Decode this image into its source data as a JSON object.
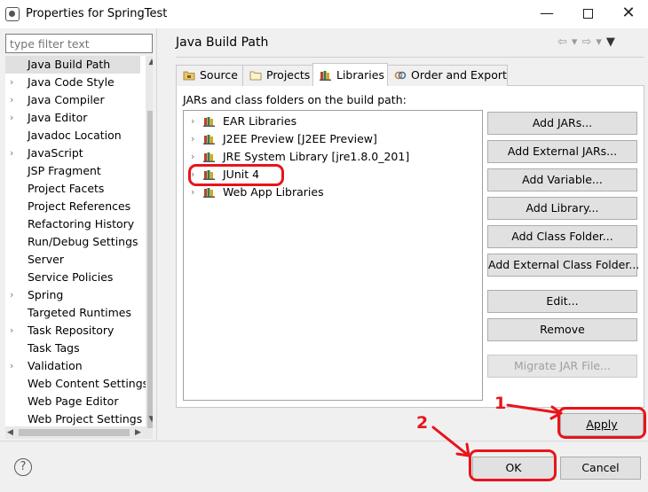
{
  "window": {
    "title": "Properties for SpringTest",
    "minimize_glyph": "—",
    "close_glyph": "✕"
  },
  "filter": {
    "placeholder": "type filter text"
  },
  "left_tree": [
    {
      "label": "Java Build Path",
      "expandable": false,
      "selected": true
    },
    {
      "label": "Java Code Style",
      "expandable": true
    },
    {
      "label": "Java Compiler",
      "expandable": true
    },
    {
      "label": "Java Editor",
      "expandable": true
    },
    {
      "label": "Javadoc Location",
      "expandable": false
    },
    {
      "label": "JavaScript",
      "expandable": true
    },
    {
      "label": "JSP Fragment",
      "expandable": false
    },
    {
      "label": "Project Facets",
      "expandable": false
    },
    {
      "label": "Project References",
      "expandable": false
    },
    {
      "label": "Refactoring History",
      "expandable": false
    },
    {
      "label": "Run/Debug Settings",
      "expandable": false
    },
    {
      "label": "Server",
      "expandable": false
    },
    {
      "label": "Service Policies",
      "expandable": false
    },
    {
      "label": "Spring",
      "expandable": true
    },
    {
      "label": "Targeted Runtimes",
      "expandable": false
    },
    {
      "label": "Task Repository",
      "expandable": true
    },
    {
      "label": "Task Tags",
      "expandable": false
    },
    {
      "label": "Validation",
      "expandable": true
    },
    {
      "label": "Web Content Settings",
      "expandable": false
    },
    {
      "label": "Web Page Editor",
      "expandable": false
    },
    {
      "label": "Web Project Settings",
      "expandable": false
    }
  ],
  "page": {
    "title": "Java Build Path",
    "tabs": [
      "Source",
      "Projects",
      "Libraries",
      "Order and Export"
    ],
    "active_tab": "Libraries",
    "jars_label": "JARs and class folders on the build path:",
    "libraries": [
      "EAR Libraries",
      "J2EE Preview [J2EE Preview]",
      "JRE System Library [jre1.8.0_201]",
      "JUnit 4",
      "Web App Libraries"
    ],
    "buttons": [
      {
        "label": "Add JARs...",
        "enabled": true
      },
      {
        "label": "Add External JARs...",
        "enabled": true
      },
      {
        "label": "Add Variable...",
        "enabled": true
      },
      {
        "label": "Add Library...",
        "enabled": true
      },
      {
        "label": "Add Class Folder...",
        "enabled": true
      },
      {
        "label": "Add External Class Folder...",
        "enabled": true
      },
      {
        "label": "Edit...",
        "enabled": true
      },
      {
        "label": "Remove",
        "enabled": true
      },
      {
        "label": "Migrate JAR File...",
        "enabled": false
      }
    ],
    "apply_label": "Apply"
  },
  "footer": {
    "ok_label": "OK",
    "cancel_label": "Cancel",
    "help_glyph": "?"
  },
  "annotations": {
    "step1": "1",
    "step2": "2",
    "color": "#e8141a"
  },
  "colors": {
    "selection": "#e0e0e0",
    "button": "#e1e1e1",
    "annotation": "#e8141a"
  }
}
